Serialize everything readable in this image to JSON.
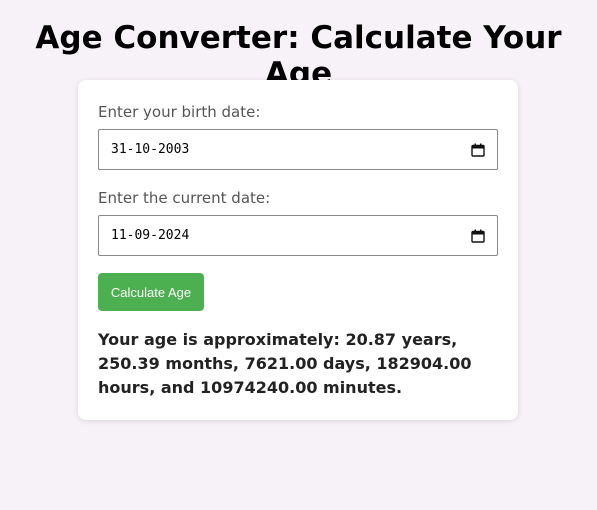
{
  "page": {
    "title": "Age Converter: Calculate Your Age"
  },
  "form": {
    "birth_label": "Enter your birth date:",
    "birth_value": "31-10-2003",
    "current_label": "Enter the current date:",
    "current_value": "11-09-2024",
    "button_label": "Calculate Age"
  },
  "result": {
    "text": "Your age is approximately: 20.87 years, 250.39 months, 7621.00 days, 182904.00 hours, and 10974240.00 minutes."
  },
  "colors": {
    "background": "#f7f2f7",
    "button": "#4caf50"
  }
}
